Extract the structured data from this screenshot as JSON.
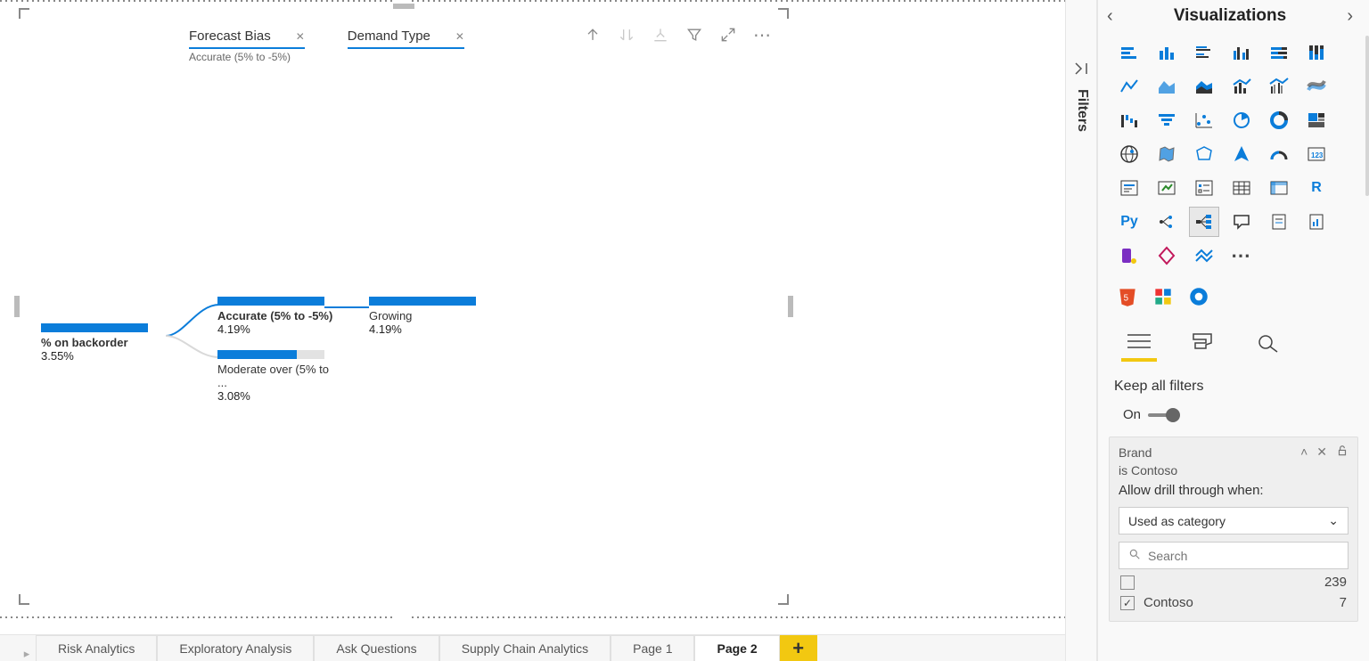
{
  "chart_data": {
    "type": "decomposition-tree",
    "root": {
      "label": "% on backorder",
      "value": "3.55%"
    },
    "levels": [
      {
        "name": "Forecast Bias",
        "subtitle": "Accurate (5% to -5%)",
        "nodes": [
          {
            "label": "Accurate (5% to -5%)",
            "value": "4.19%",
            "fill_pct": 100,
            "selected": true
          },
          {
            "label": "Moderate over (5% to ...",
            "value": "3.08%",
            "fill_pct": 74,
            "selected": false
          }
        ]
      },
      {
        "name": "Demand Type",
        "subtitle": "",
        "nodes": [
          {
            "label": "Growing",
            "value": "4.19%",
            "fill_pct": 100,
            "selected": false
          }
        ]
      }
    ]
  },
  "visual_actions": {
    "drill_up": "Drill up",
    "drill_down": "Drill down",
    "expand": "Expand",
    "filter": "Filter",
    "focus": "Focus mode",
    "more": "More options"
  },
  "filters_panel": {
    "label": "Filters"
  },
  "viz_panel": {
    "title": "Visualizations",
    "keep_all": "Keep all filters",
    "toggle_label": "On"
  },
  "drillthrough_card": {
    "title": "Brand",
    "condition": "is Contoso",
    "allow_label": "Allow drill through when:",
    "dropdown_value": "Used as category",
    "search_placeholder": "Search",
    "rows": [
      {
        "label": "",
        "count": "239",
        "checked": false
      },
      {
        "label": "Contoso",
        "count": "7",
        "checked": true
      }
    ]
  },
  "pages": {
    "items": [
      {
        "label": "Risk Analytics",
        "active": false
      },
      {
        "label": "Exploratory Analysis",
        "active": false
      },
      {
        "label": "Ask Questions",
        "active": false
      },
      {
        "label": "Supply Chain Analytics",
        "active": false
      },
      {
        "label": "Page 1",
        "active": false
      },
      {
        "label": "Page 2",
        "active": true
      }
    ],
    "add_label": "+"
  }
}
